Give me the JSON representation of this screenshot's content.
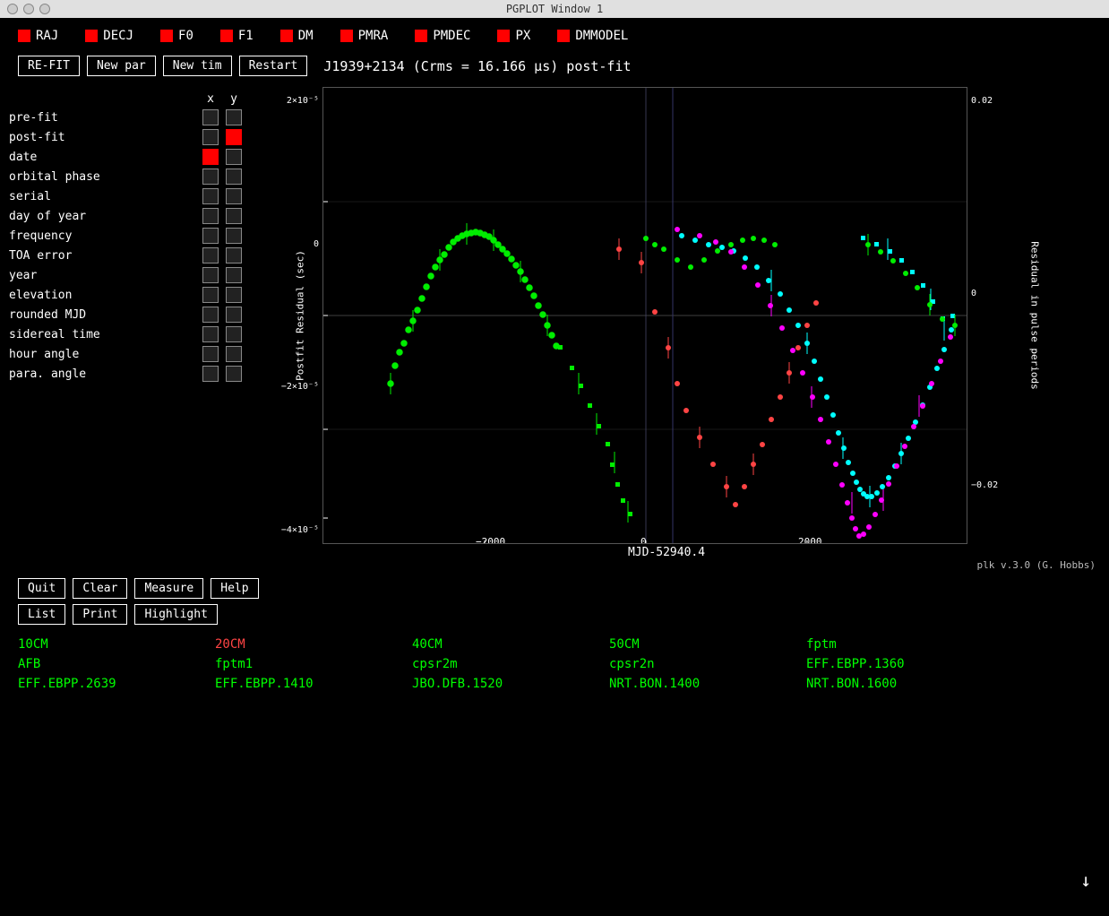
{
  "titleBar": {
    "title": "PGPLOT Window 1"
  },
  "params": [
    {
      "label": "RAJ",
      "color": "red"
    },
    {
      "label": "DECJ",
      "color": "red"
    },
    {
      "label": "F0",
      "color": "red"
    },
    {
      "label": "F1",
      "color": "red"
    },
    {
      "label": "DM",
      "color": "red"
    },
    {
      "label": "PMRA",
      "color": "red"
    },
    {
      "label": "PMDEC",
      "color": "red"
    },
    {
      "label": "PX",
      "color": "red"
    },
    {
      "label": "DMMODEL",
      "color": "red"
    }
  ],
  "toolbar": {
    "refit": "RE-FIT",
    "newpar": "New par",
    "newtim": "New tim",
    "restart": "Restart",
    "plotTitle": "J1939+2134 (Crms = 16.166 µs) post-fit"
  },
  "axisHeader": {
    "x": "x",
    "y": "y"
  },
  "rows": [
    {
      "label": "pre-fit",
      "x": false,
      "y": false
    },
    {
      "label": "post-fit",
      "x": false,
      "y": true,
      "yRed": true
    },
    {
      "label": "date",
      "x": true,
      "xRed": true,
      "y": false
    },
    {
      "label": "orbital phase",
      "x": false,
      "y": false
    },
    {
      "label": "serial",
      "x": false,
      "y": false
    },
    {
      "label": "day of year",
      "x": false,
      "y": false
    },
    {
      "label": "frequency",
      "x": false,
      "y": false
    },
    {
      "label": "TOA error",
      "x": false,
      "y": false
    },
    {
      "label": "year",
      "x": false,
      "y": false
    },
    {
      "label": "elevation",
      "x": false,
      "y": false
    },
    {
      "label": "rounded MJD",
      "x": false,
      "y": false
    },
    {
      "label": "sidereal time",
      "x": false,
      "y": false
    },
    {
      "label": "hour angle",
      "x": false,
      "y": false
    },
    {
      "label": "para. angle",
      "x": false,
      "y": false
    }
  ],
  "yAxisLeft": "Postfit Residual (sec)",
  "yAxisRight": "Residual in pulse periods",
  "xAxisLabel": "MJD-52940.4",
  "yTicks": [
    "2×10⁻⁵",
    "0",
    "-2×10⁻⁵",
    "-4×10⁻⁵"
  ],
  "yTicksRight": [
    "0.02",
    "0",
    "-0.02"
  ],
  "xTicks": [
    "-2000",
    "0",
    "2000"
  ],
  "plkVersion": "plk v.3.0 (G. Hobbs)",
  "bottomToolbar1": {
    "quit": "Quit",
    "clear": "Clear",
    "measure": "Measure",
    "help": "Help"
  },
  "bottomToolbar2": {
    "list": "List",
    "print": "Print",
    "highlight": "Highlight"
  },
  "legend": [
    [
      {
        "label": "10CM",
        "color": "green"
      },
      {
        "label": "20CM",
        "color": "red"
      },
      {
        "label": "40CM",
        "color": "green"
      },
      {
        "label": "50CM",
        "color": "green"
      },
      {
        "label": "fptm",
        "color": "green"
      }
    ],
    [
      {
        "label": "AFB",
        "color": "green"
      },
      {
        "label": "fptm1",
        "color": "green"
      },
      {
        "label": "cpsr2m",
        "color": "green"
      },
      {
        "label": "cpsr2n",
        "color": "green"
      },
      {
        "label": "EFF.EBPP.1360",
        "color": "green"
      }
    ],
    [
      {
        "label": "EFF.EBPP.2639",
        "color": "green"
      },
      {
        "label": "EFF.EBPP.1410",
        "color": "green"
      },
      {
        "label": "JBO.DFB.1520",
        "color": "green"
      },
      {
        "label": "NRT.BON.1400",
        "color": "green"
      },
      {
        "label": "NRT.BON.1600",
        "color": "green"
      }
    ]
  ]
}
